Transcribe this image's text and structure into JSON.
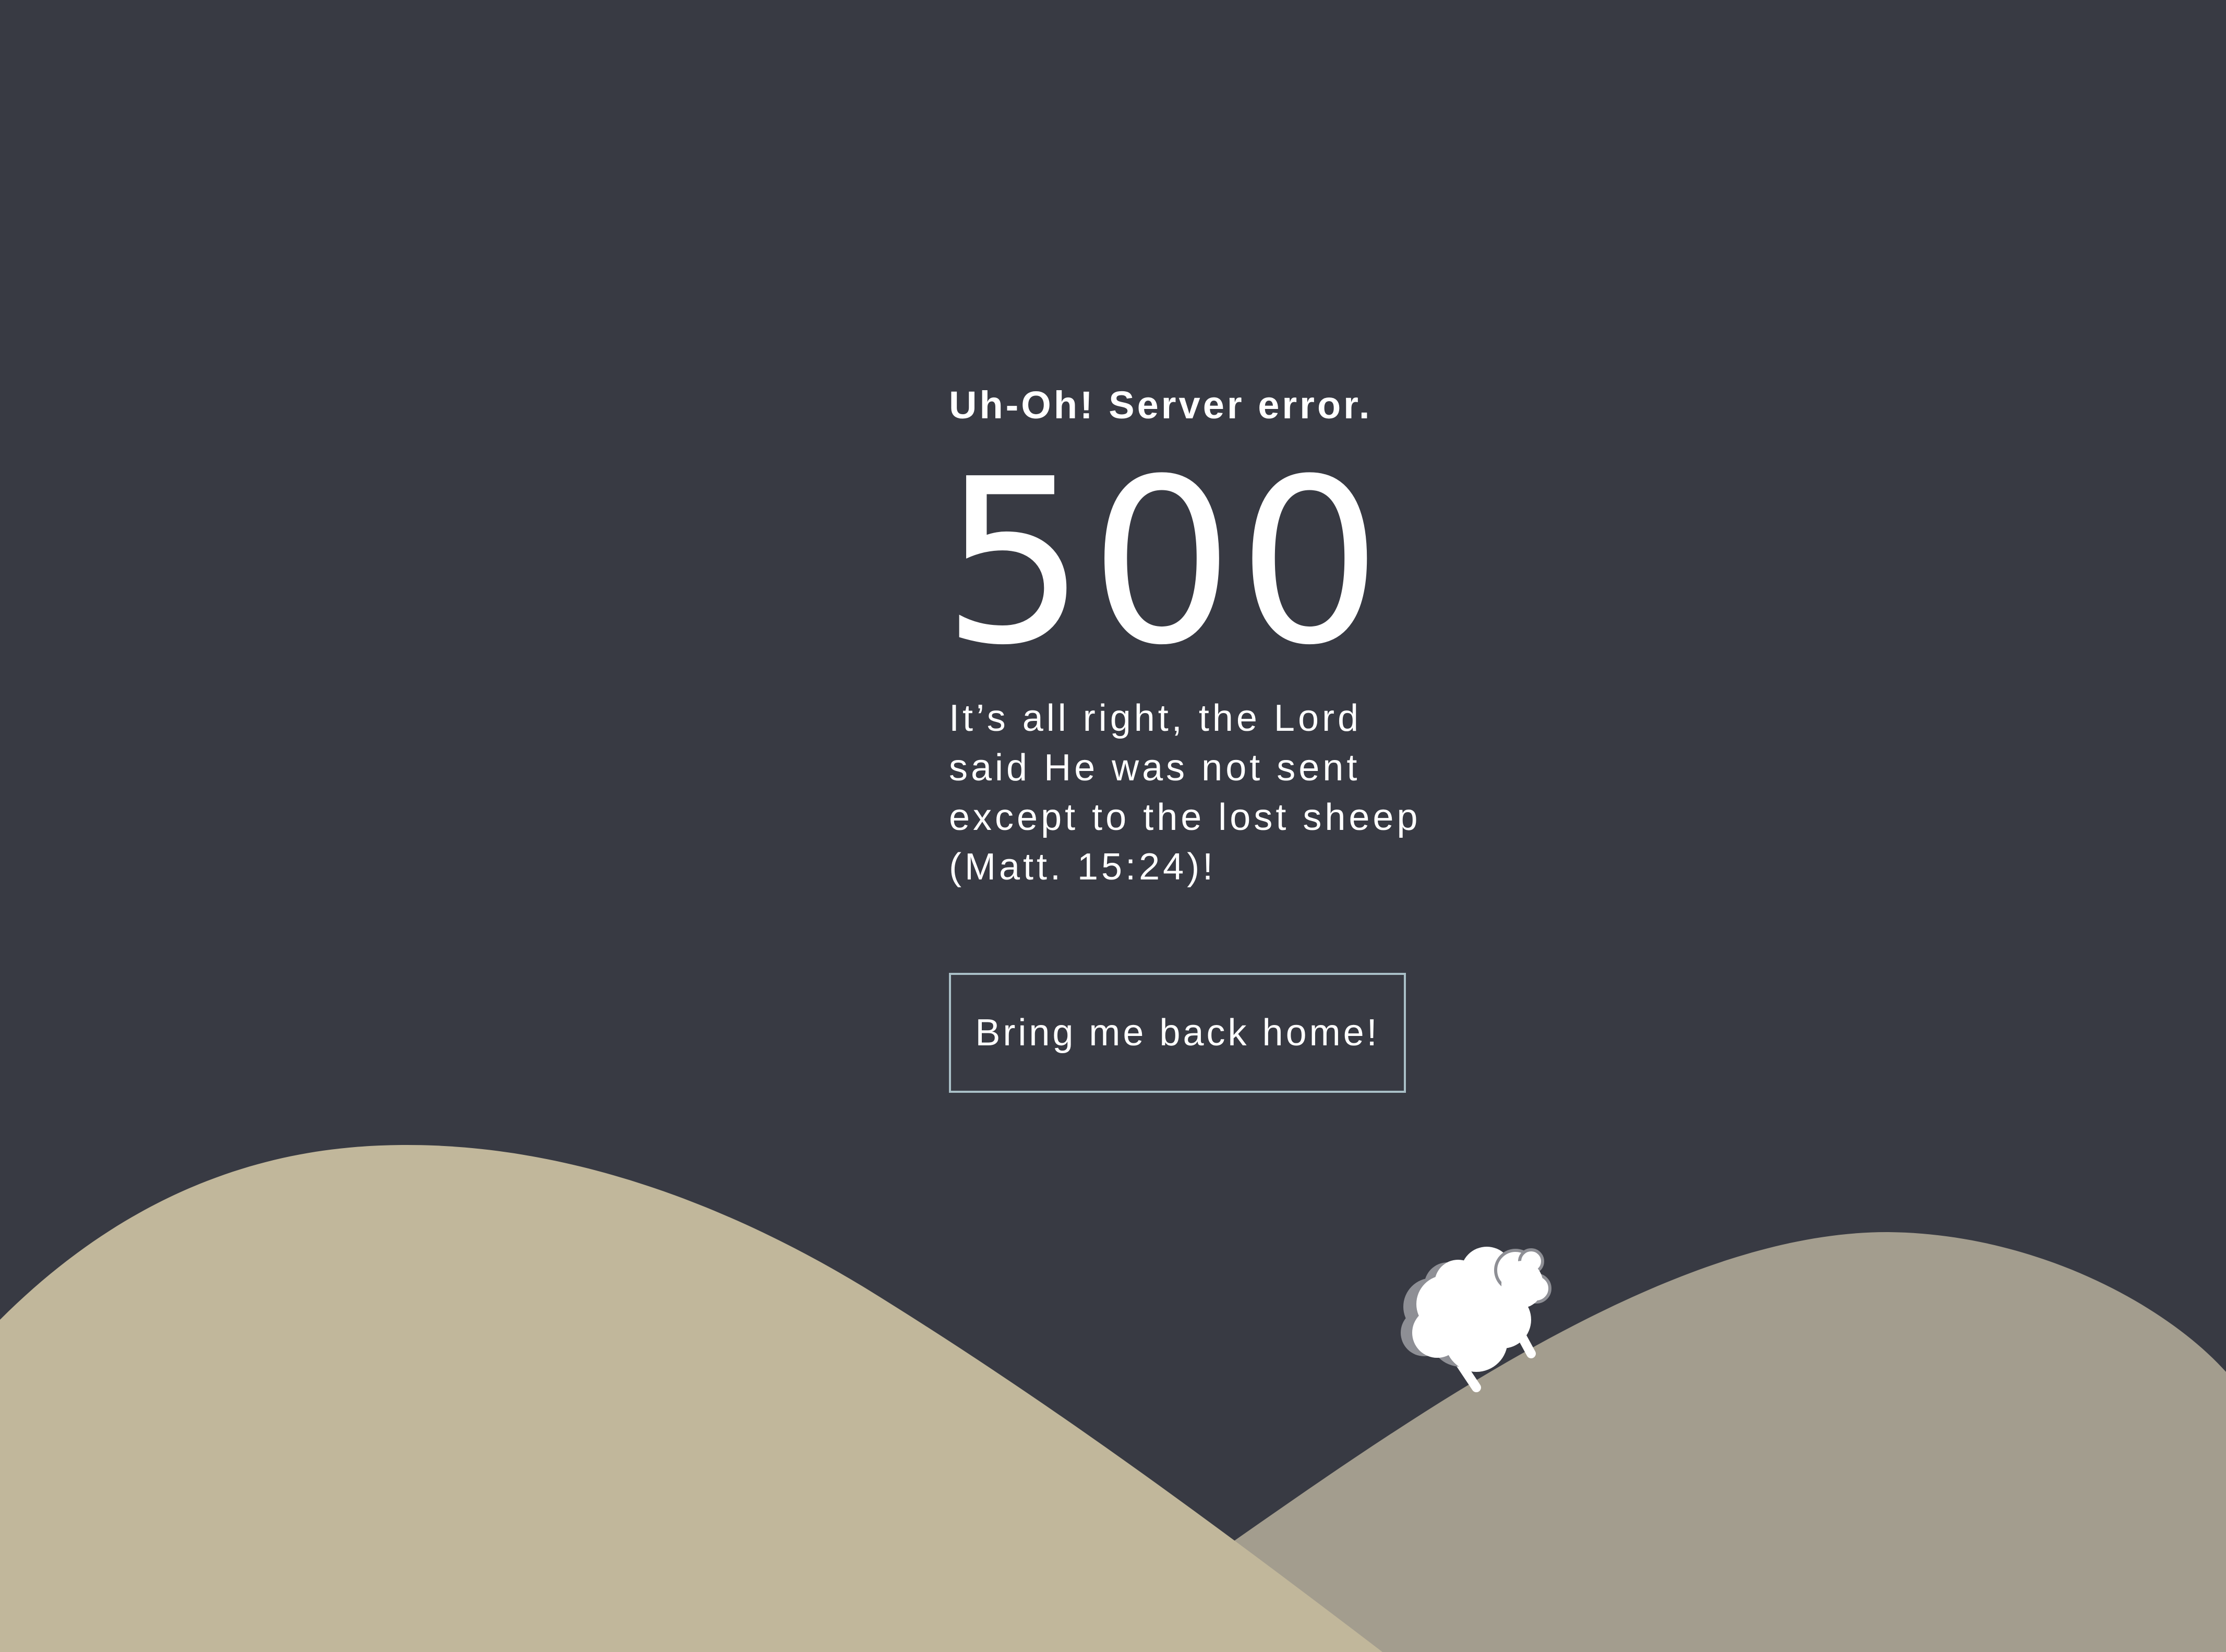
{
  "error": {
    "subtitle": "Uh-Oh! Server error.",
    "code": "500",
    "message_lines": [
      "It’s all right, the Lord",
      "said He was not sent",
      "except to the lost sheep",
      "(Matt. 15:24)!"
    ],
    "button_label": "Bring me back home!"
  },
  "colors": {
    "background": "#383a43",
    "hill_front": "#c1b79b",
    "hill_back": "#a39d8e",
    "button_border": "#a9bfc7",
    "text": "#ffffff",
    "sheep_body": "#ffffff",
    "sheep_shadow": "#8e8f95"
  }
}
